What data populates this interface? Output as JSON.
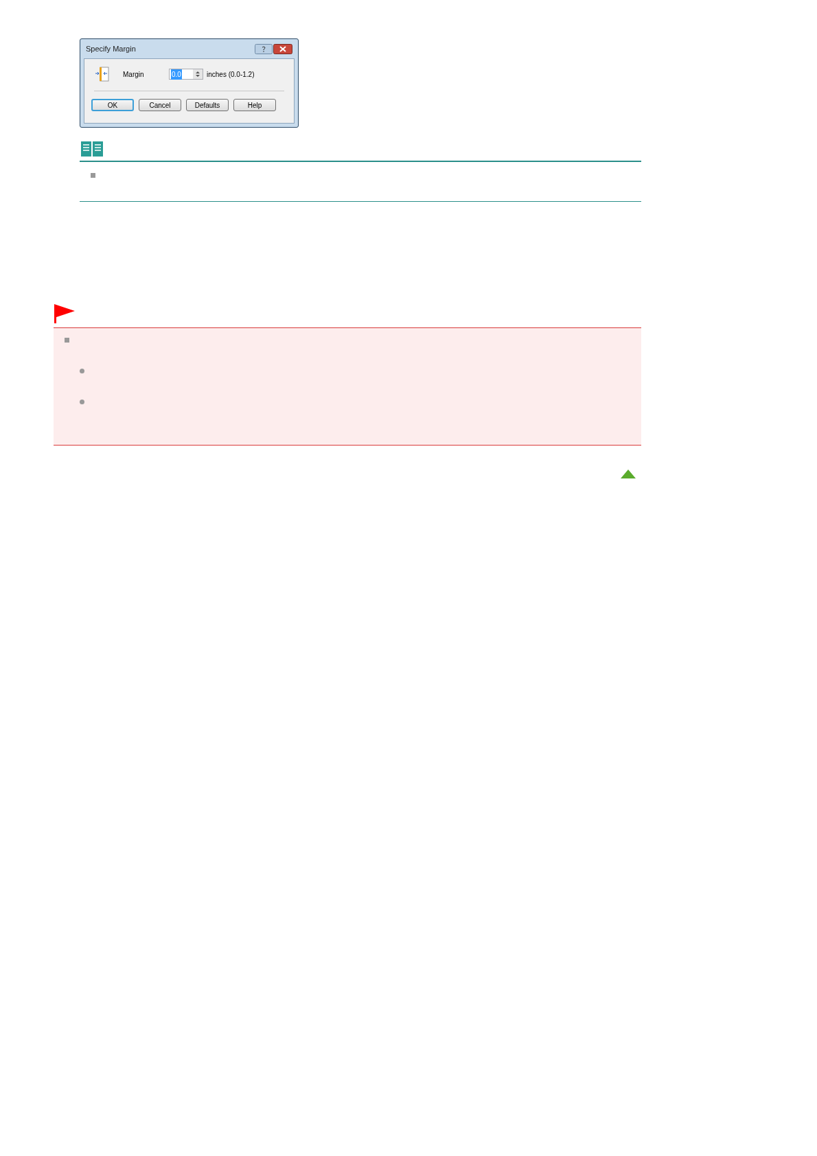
{
  "dialog": {
    "title": "Specify Margin",
    "field": {
      "label": "Margin",
      "value": "0.0",
      "unit": "inches (0.0-1.2)",
      "selected": true
    },
    "buttons": [
      {
        "label": "OK",
        "default": true
      },
      {
        "label": "Cancel",
        "default": false
      },
      {
        "label": "Defaults",
        "default": false
      },
      {
        "label": "Help",
        "default": false
      }
    ]
  }
}
